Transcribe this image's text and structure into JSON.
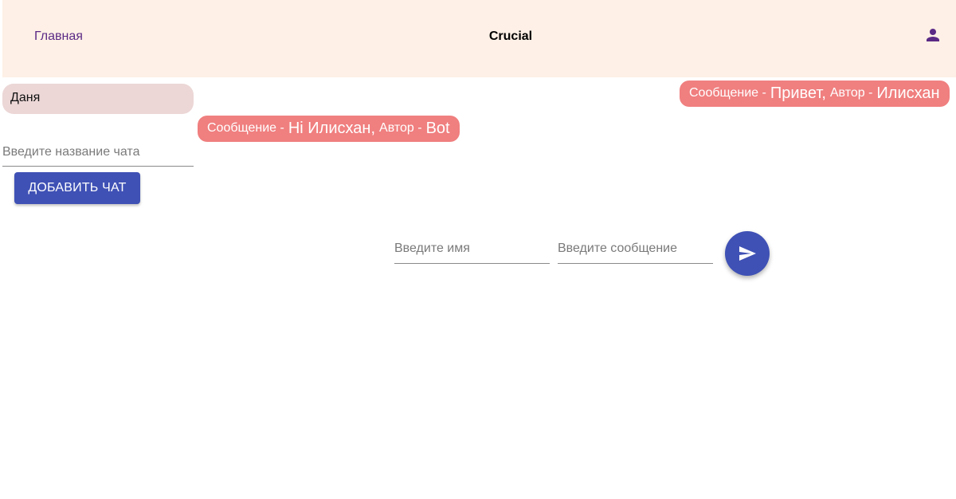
{
  "header": {
    "home_label": "Главная",
    "app_title": "Crucial",
    "user_icon": "person-icon",
    "background_color": "#fef0e6",
    "link_color": "#5b2a86"
  },
  "sidebar": {
    "chats": [
      {
        "label": "Даня"
      }
    ],
    "chat_name_placeholder": "Введите название чата",
    "add_chat_label": "Добавить чат"
  },
  "messages": [
    {
      "message_prefix": "Сообщение -",
      "text": "Привет,",
      "author_prefix": "Автор -",
      "author": "Илисхан"
    },
    {
      "message_prefix": "Сообщение -",
      "text": "Hi Илисхан,",
      "author_prefix": "Автор -",
      "author": "Bot"
    }
  ],
  "composer": {
    "name_placeholder": "Введите имя",
    "message_placeholder": "Введите сообщение",
    "send_icon": "send-icon"
  },
  "colors": {
    "primary": "#3f51b5",
    "message_bubble": "#f07f7f",
    "chat_item": "#ecd6d6"
  }
}
